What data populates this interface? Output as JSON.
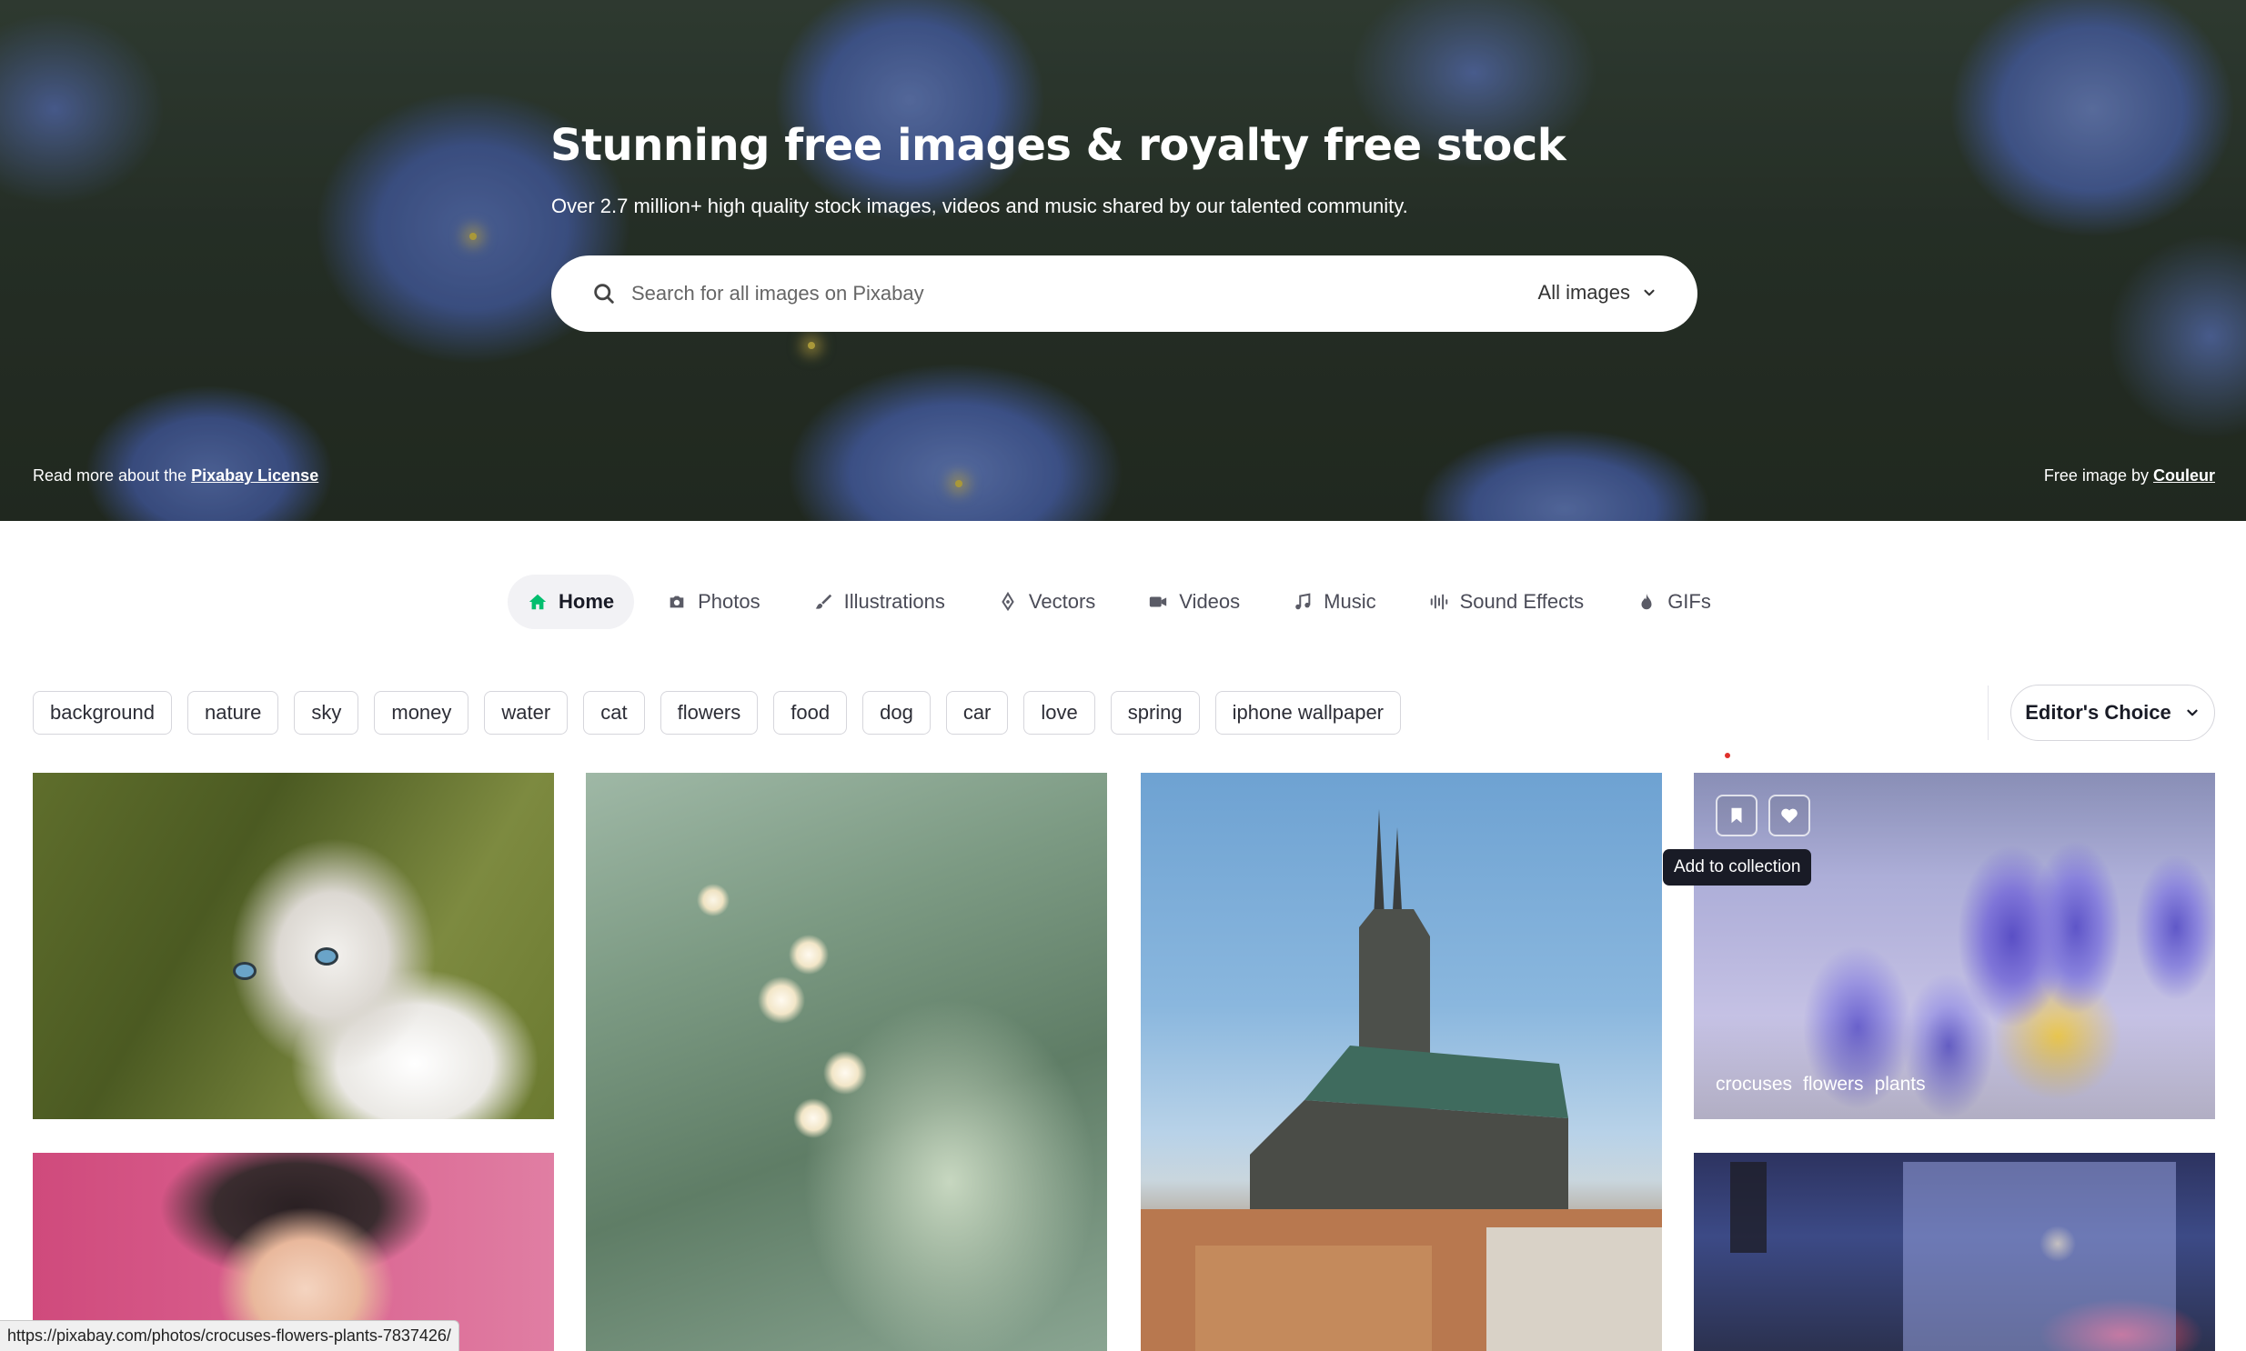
{
  "hero": {
    "title": "Stunning free images & royalty free stock",
    "subtitle": "Over 2.7 million+ high quality stock images, videos and music shared by our talented community.",
    "search_placeholder": "Search for all images on Pixabay",
    "search_filter": "All images",
    "license_prefix": "Read more about the ",
    "license_link": "Pixabay License",
    "credit_prefix": "Free image by ",
    "credit_link": "Couleur"
  },
  "nav": [
    {
      "label": "Home",
      "icon": "home-icon",
      "active": true
    },
    {
      "label": "Photos",
      "icon": "camera-icon"
    },
    {
      "label": "Illustrations",
      "icon": "brush-icon"
    },
    {
      "label": "Vectors",
      "icon": "pen-nib-icon"
    },
    {
      "label": "Videos",
      "icon": "video-camera-icon"
    },
    {
      "label": "Music",
      "icon": "music-note-icon"
    },
    {
      "label": "Sound Effects",
      "icon": "sound-wave-icon"
    },
    {
      "label": "GIFs",
      "icon": "flame-icon"
    }
  ],
  "tags": [
    "background",
    "nature",
    "sky",
    "money",
    "water",
    "cat",
    "flowers",
    "food",
    "dog",
    "car",
    "love",
    "spring",
    "iphone wallpaper"
  ],
  "sort": {
    "label": "Editor's Choice"
  },
  "hovered_image": {
    "tags": [
      "crocuses",
      "flowers",
      "plants"
    ],
    "tooltip": "Add to collection"
  },
  "status_url": "https://pixabay.com/photos/crocuses-flowers-plants-7837426/",
  "colors": {
    "accent": "#02be6e",
    "text": "#191b26",
    "tooltip_bg": "#191b26"
  }
}
